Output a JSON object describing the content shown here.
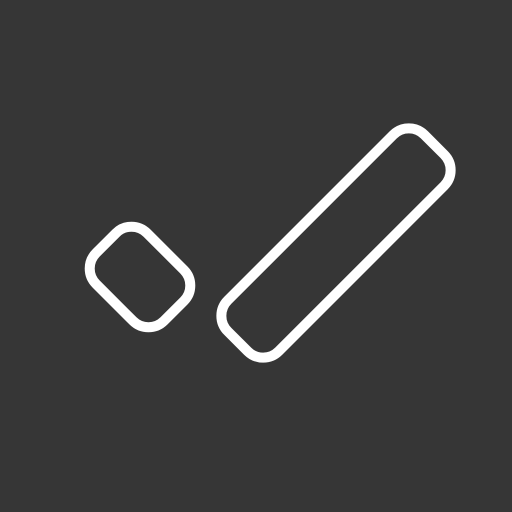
{
  "icon": {
    "name": "check-mark-outline-icon",
    "background_color": "#363636",
    "stroke_color": "#ffffff"
  }
}
